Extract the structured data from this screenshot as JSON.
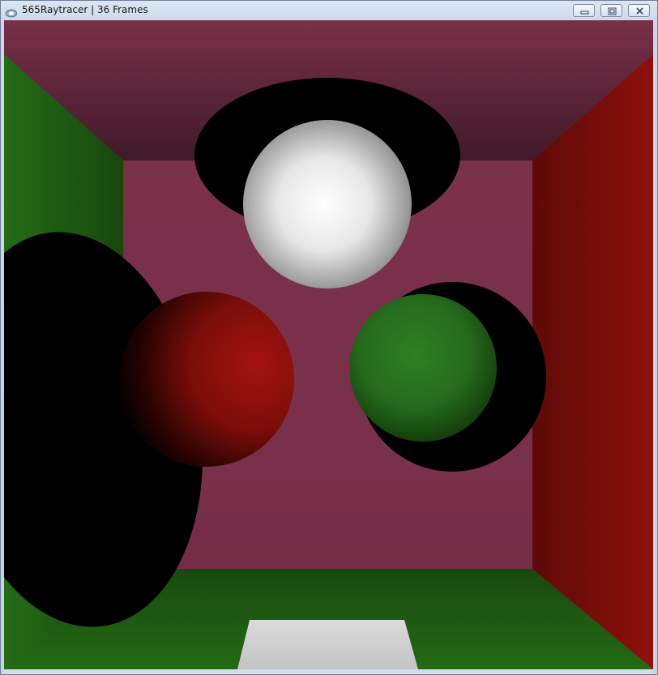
{
  "window": {
    "title": "565Raytracer | 36 Frames"
  },
  "title_controls": {
    "minimize_icon": "minimize-icon",
    "maximize_icon": "restore-icon",
    "close_icon": "close-icon"
  },
  "scene": {
    "colors": {
      "back_wall": "#7a3149",
      "ceiling": "#75304a",
      "left_wall": "#236d15",
      "right_wall": "#8f0f0b",
      "floor": "#1f6415",
      "area_light": "#d2d2d2",
      "sphere_white": "#ffffff",
      "sphere_red": "#a3120d",
      "sphere_green": "#2d7d22",
      "shadow": "#000000"
    }
  }
}
